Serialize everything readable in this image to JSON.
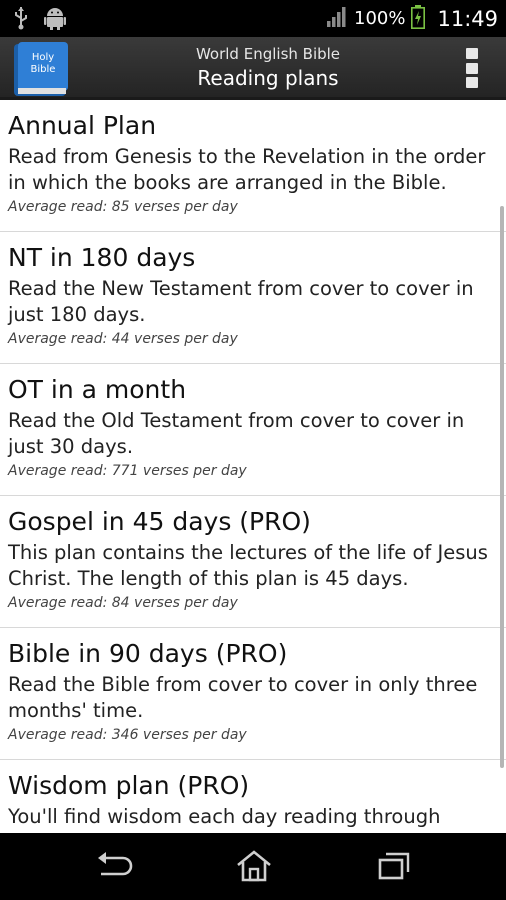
{
  "status_bar": {
    "icons": [
      "usb-icon",
      "android-debug-icon",
      "signal-icon",
      "battery-charging-icon"
    ],
    "battery_percent": "100%",
    "time": "11:49"
  },
  "action_bar": {
    "app_icon_text": [
      "Holy",
      "Bible"
    ],
    "subtitle": "World English Bible",
    "title": "Reading plans",
    "overflow_icon": "overflow-menu-icon"
  },
  "plans": [
    {
      "title": "Annual Plan",
      "description": "Read from Genesis to the Revelation in the order in which the books are arranged in the Bible.",
      "average": "Average read: 85 verses per day"
    },
    {
      "title": "NT in 180 days",
      "description": "Read the New Testament from cover to cover in just 180 days.",
      "average": "Average read: 44 verses per day"
    },
    {
      "title": "OT in a month",
      "description": "Read the Old Testament from cover to cover in just 30 days.",
      "average": "Average read: 771 verses per day"
    },
    {
      "title": "Gospel in 45 days (PRO)",
      "description": "This plan contains the lectures of the life of Jesus Christ. The length of this plan is 45 days.",
      "average": "Average read: 84 verses per day"
    },
    {
      "title": "Bible in 90 days (PRO)",
      "description": "Read the Bible from cover to cover in only three months' time.",
      "average": "Average read: 346 verses per day"
    },
    {
      "title": "Wisdom plan (PRO)",
      "description": "You'll find wisdom each day reading through",
      "average": ""
    }
  ],
  "nav_bar": {
    "buttons": [
      "back-icon",
      "home-icon",
      "recent-apps-icon"
    ]
  },
  "colors": {
    "action_bar": "#2e2e2e",
    "app_icon_blue": "#2f7fd6",
    "battery_green": "#7ac143"
  }
}
